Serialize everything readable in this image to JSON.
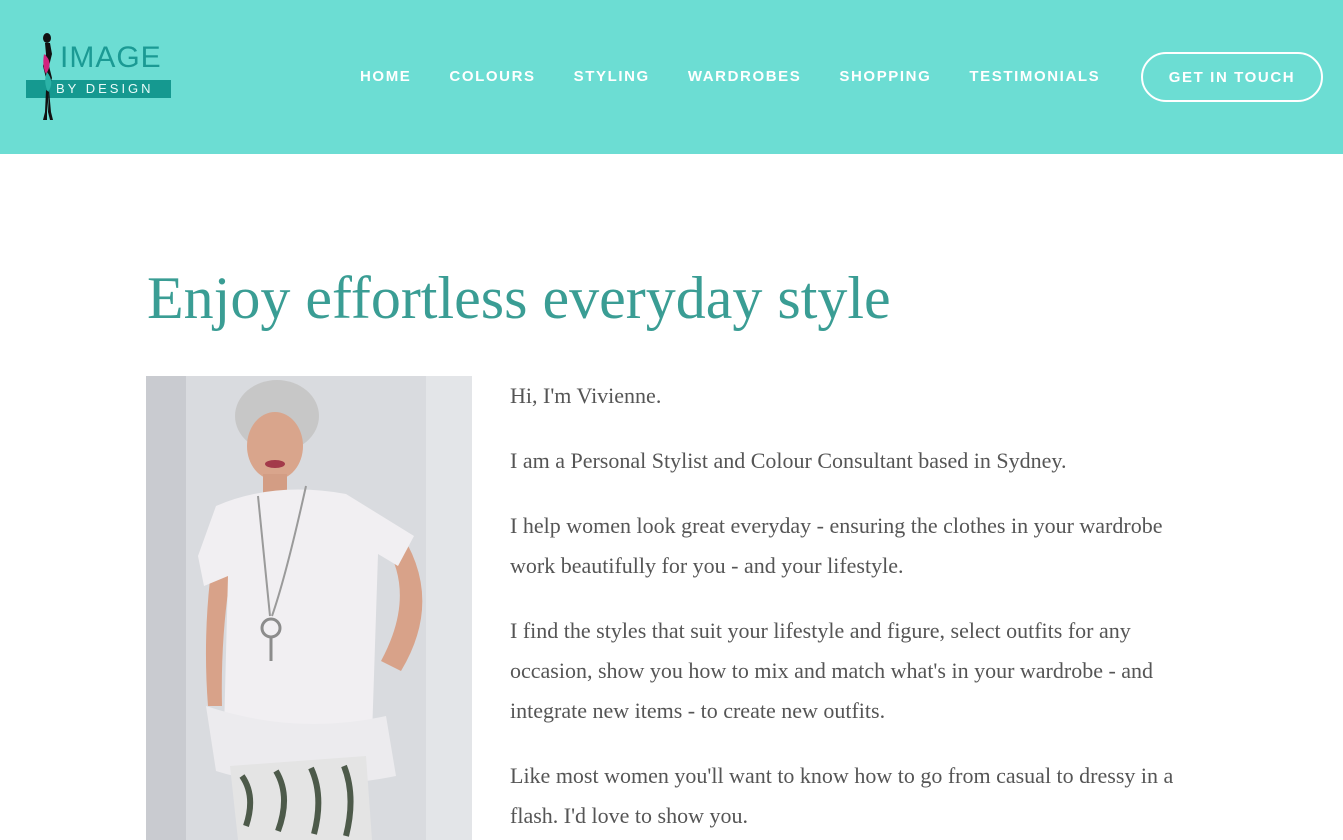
{
  "header": {
    "logo": {
      "top_text": "IMAGE",
      "bottom_text": "BY DESIGN"
    },
    "nav": [
      {
        "label": "HOME"
      },
      {
        "label": "COLOURS"
      },
      {
        "label": "STYLING"
      },
      {
        "label": "WARDROBES"
      },
      {
        "label": "SHOPPING"
      },
      {
        "label": "TESTIMONIALS"
      }
    ],
    "cta_label": "GET IN TOUCH"
  },
  "main": {
    "headline": "Enjoy effortless everyday style",
    "paragraphs": [
      "Hi,  I'm Vivienne.",
      "I am a Personal Stylist and Colour Consultant based in Sydney.",
      "I help women look great everyday - ensuring the clothes in your wardrobe work beautifully for you - and your lifestyle.",
      "I find the styles that suit your lifestyle and figure, select outfits for any occasion, show you how to mix and match what's in your wardrobe - and integrate new items - to create new outfits.",
      "Like most women you'll want to know how to go from casual to dressy in a flash. I'd love to show you."
    ]
  },
  "colors": {
    "header_bg": "#6cddd3",
    "headline": "#3a9d94",
    "body_text": "#555555",
    "logo_teal": "#159990",
    "logo_magenta": "#d2247e"
  }
}
